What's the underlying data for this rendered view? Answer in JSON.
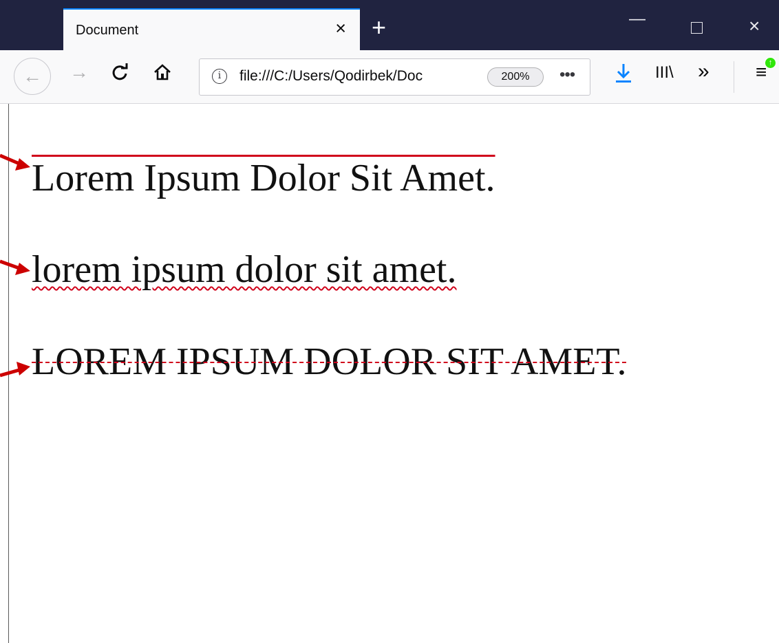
{
  "browser": {
    "tab": {
      "title": "Document",
      "close_glyph": "×"
    },
    "new_tab_glyph": "+",
    "window_controls": {
      "minimize": "—",
      "close": "×"
    },
    "toolbar": {
      "back_glyph": "←",
      "forward_glyph": "→",
      "reload_glyph": "C",
      "home_glyph": "⌂",
      "url": "file:///C:/Users/Qodirbek/Doc",
      "zoom": "200%",
      "more_glyph": "•••",
      "download_glyph": "↓",
      "library_glyph": "III\\",
      "overflow_glyph": "»",
      "menu_glyph": "≡",
      "update_glyph": "↑"
    },
    "icons": [
      "back-arrow-icon",
      "forward-arrow-icon",
      "reload-icon",
      "home-icon",
      "info-icon",
      "page-actions-icon",
      "download-icon",
      "library-icon",
      "overflow-icon",
      "menu-icon",
      "update-badge-icon"
    ]
  },
  "content": {
    "lines": [
      {
        "text": "Lorem Ipsum Dolor Sit Amet."
      },
      {
        "text": "lorem ipsum dolor sit amet."
      },
      {
        "text": "LOREM IPSUM DOLOR SIT AMET."
      }
    ]
  },
  "colors": {
    "tabstrip": "#202340",
    "tab_active_accent": "#0a84ff",
    "decoration_red": "#d0021b",
    "arrow_red": "#cc0000",
    "download_blue": "#0a84ff",
    "update_green": "#30e60b"
  }
}
